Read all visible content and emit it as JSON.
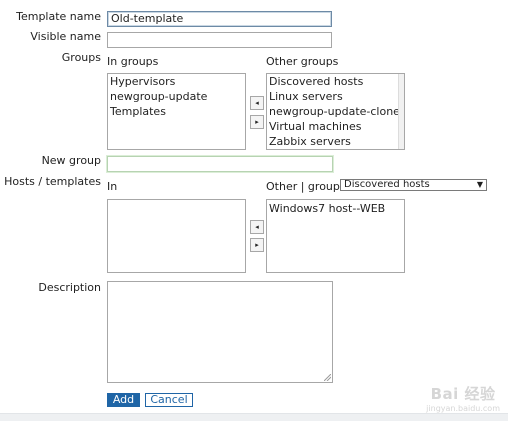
{
  "form": {
    "template_name_label": "Template name",
    "template_name_value": "Old-template",
    "visible_name_label": "Visible name",
    "visible_name_value": "",
    "groups_label": "Groups",
    "in_groups_label": "In groups",
    "other_groups_label": "Other groups",
    "in_groups": [
      "Hypervisors",
      "newgroup-update",
      "Templates"
    ],
    "other_groups": [
      "Discovered hosts",
      "Linux servers",
      "newgroup-update-clone",
      "Virtual machines",
      "Zabbix servers"
    ],
    "move_left_glyph": "◂",
    "move_right_glyph": "▸",
    "new_group_label": "New group",
    "new_group_value": "",
    "hosts_templates_label": "Hosts / templates",
    "in_label": "In",
    "other_group_label": "Other | group",
    "other_group_select": "Discovered hosts",
    "other_hosts": [
      "Windows7 host--WEB"
    ],
    "description_label": "Description",
    "description_value": ""
  },
  "actions": {
    "add_label": "Add",
    "cancel_label": "Cancel"
  },
  "watermark": {
    "brand": "Bai 经验",
    "url": "jingyan.baidu.com"
  },
  "colors": {
    "accent": "#1f65a6",
    "border": "#a7a7a7"
  }
}
